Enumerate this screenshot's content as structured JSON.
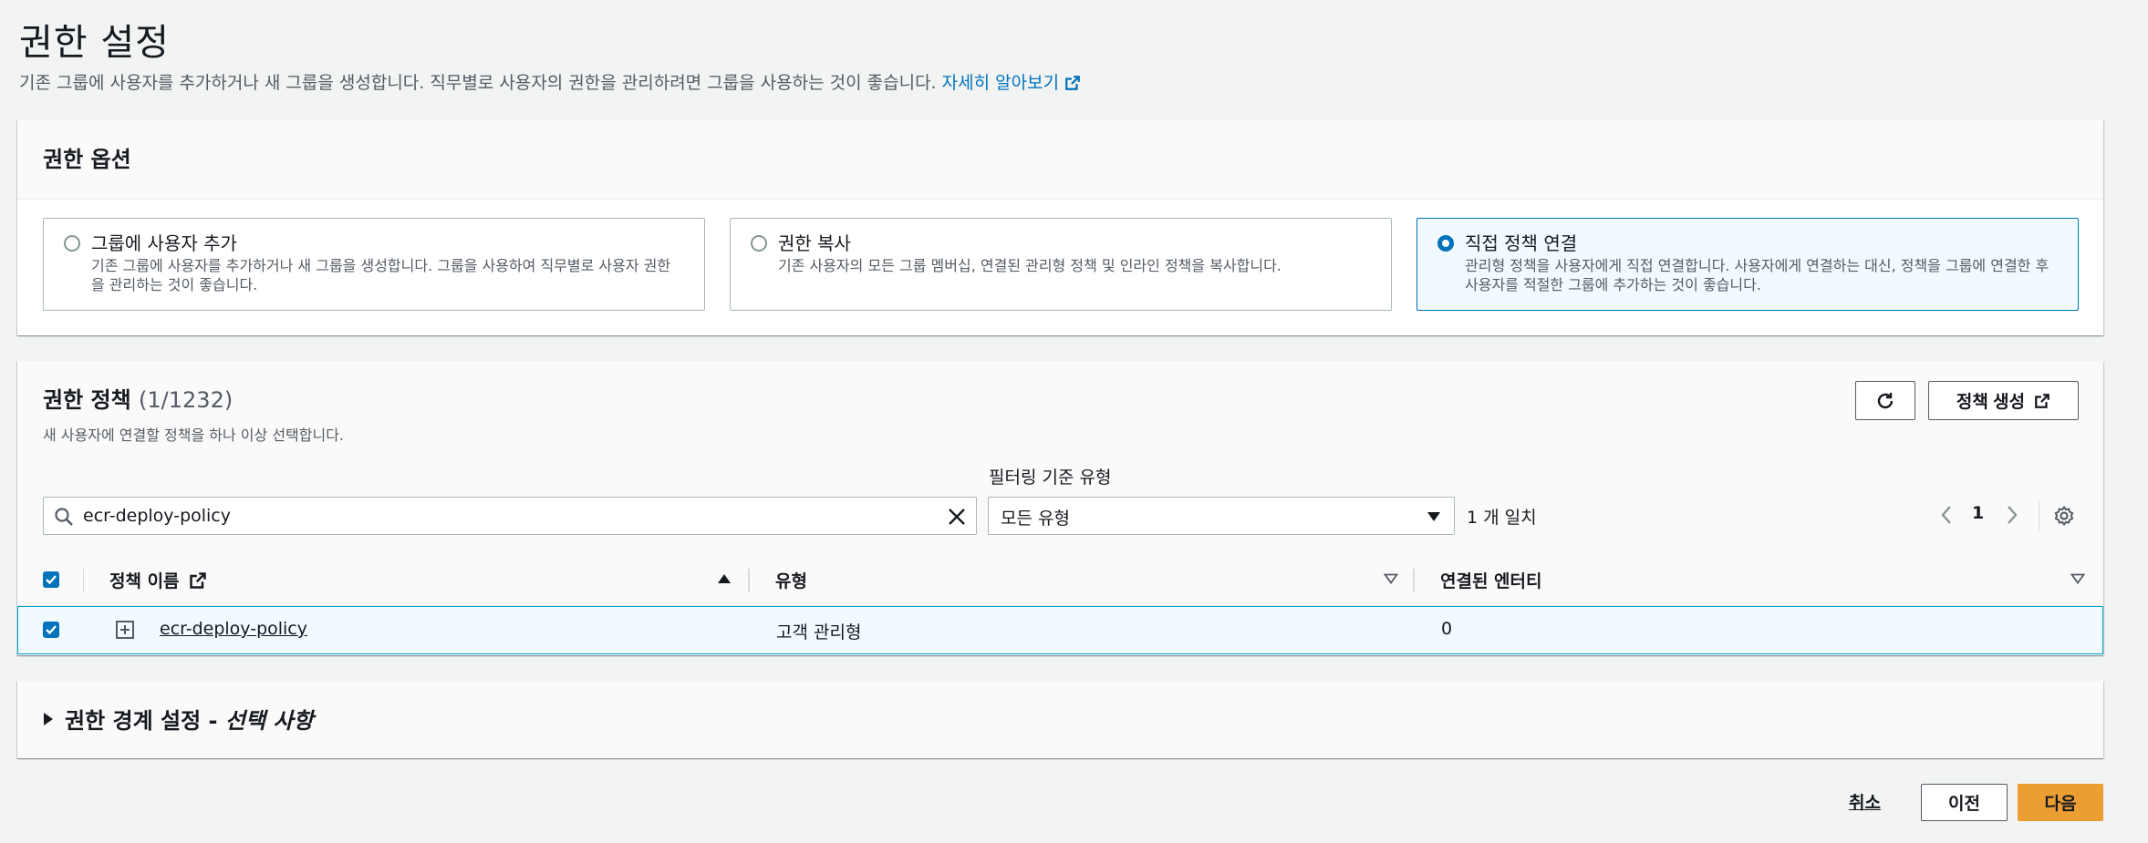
{
  "header": {
    "title": "권한 설정",
    "description": "기존 그룹에 사용자를 추가하거나 새 그룹을 생성합니다. 직무별로 사용자의 권한을 관리하려면 그룹을 사용하는 것이 좋습니다.",
    "learn_more": "자세히 알아보기"
  },
  "permission_options": {
    "title": "권한 옵션",
    "options": [
      {
        "label": "그룹에 사용자 추가",
        "description": "기존 그룹에 사용자를 추가하거나 새 그룹을 생성합니다. 그룹을 사용하여 직무별로 사용자 권한을 관리하는 것이 좋습니다.",
        "selected": false
      },
      {
        "label": "권한 복사",
        "description": "기존 사용자의 모든 그룹 멤버십, 연결된 관리형 정책 및 인라인 정책을 복사합니다.",
        "selected": false
      },
      {
        "label": "직접 정책 연결",
        "description": "관리형 정책을 사용자에게 직접 연결합니다. 사용자에게 연결하는 대신, 정책을 그룹에 연결한 후 사용자를 적절한 그룹에 추가하는 것이 좋습니다.",
        "selected": true
      }
    ]
  },
  "policies": {
    "title": "권한 정책",
    "count": "(1/1232)",
    "description": "새 사용자에 연결할 정책을 하나 이상 선택합니다.",
    "create_policy": "정책 생성",
    "filter_label": "필터링 기준 유형",
    "search_value": "ecr-deploy-policy",
    "filter_value": "모든 유형",
    "match_count": "1 개 일치",
    "page": "1",
    "columns": [
      "정책 이름",
      "유형",
      "연결된 엔터티"
    ],
    "rows": [
      {
        "name": "ecr-deploy-policy",
        "type": "고객 관리형",
        "entities": "0",
        "checked": true
      }
    ]
  },
  "boundary": {
    "title": "권한 경계 설정 - ",
    "optional": "선택 사항"
  },
  "footer": {
    "cancel": "취소",
    "previous": "이전",
    "next": "다음"
  },
  "colors": {
    "primary": "#0073bb",
    "accent_button": "#ec9e33",
    "background": "#f2f3f3"
  }
}
